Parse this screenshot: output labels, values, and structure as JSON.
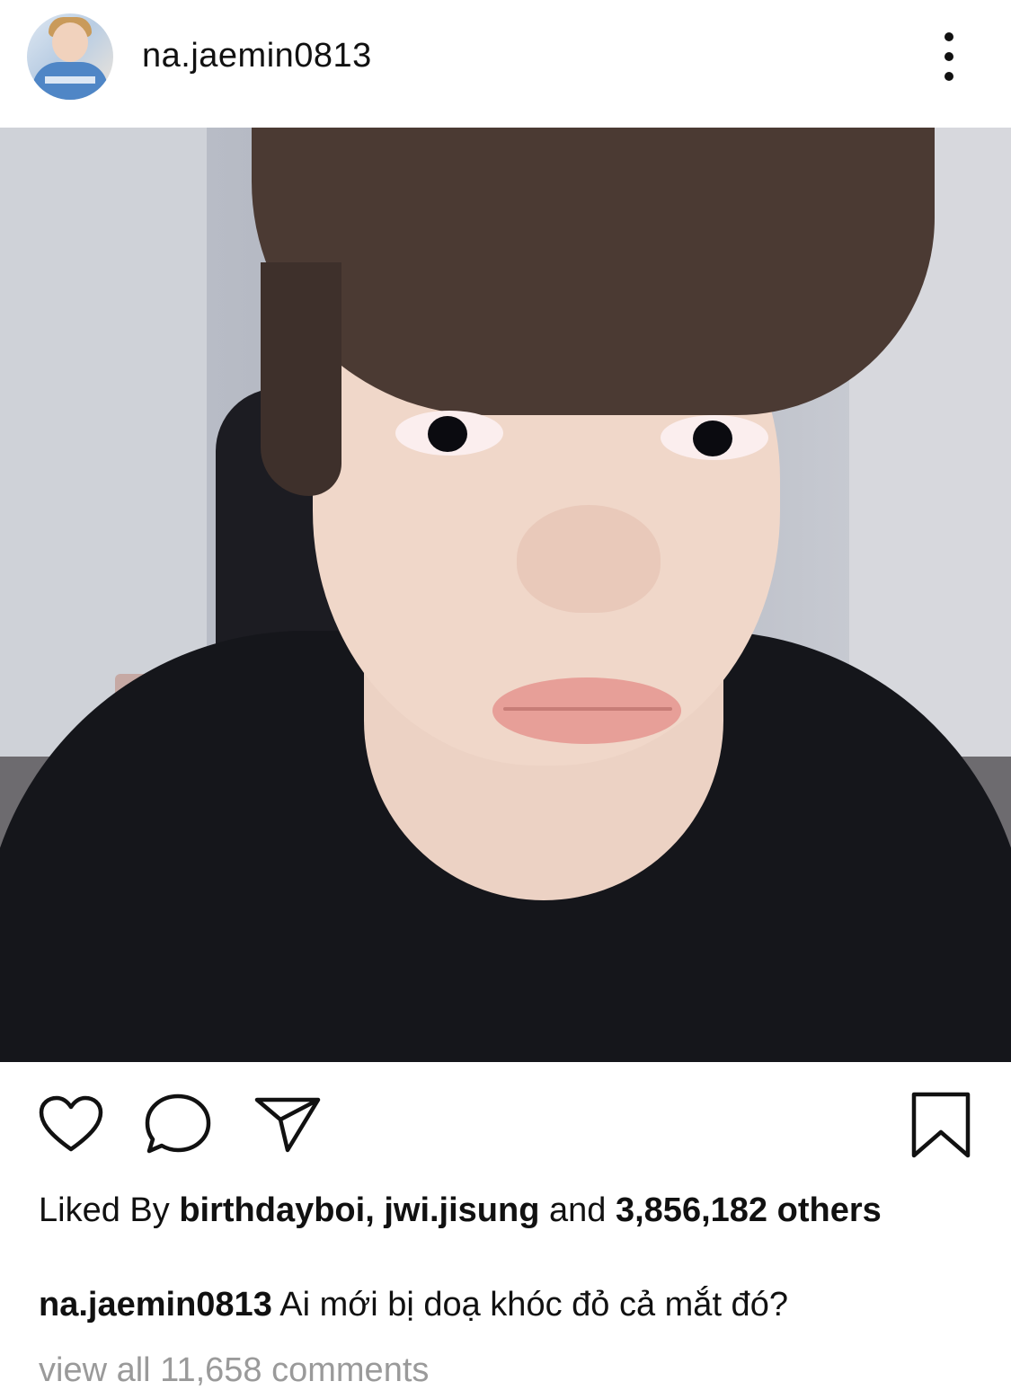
{
  "post": {
    "username": "na.jaemin0813",
    "likes": {
      "prefix": "Liked By",
      "user1": "birthdayboi,",
      "user2": "jwi.jisung",
      "connector": "and",
      "count": "3,856,182",
      "suffix": "others"
    },
    "caption": {
      "username": "na.jaemin0813",
      "text": "Ai mới bị doạ khóc đỏ cả mắt đó?"
    },
    "view_comments": "view all 11,658 comments"
  },
  "icons": {
    "more": "more-vertical-icon",
    "like": "heart-icon",
    "comment": "comment-icon",
    "share": "send-icon",
    "save": "bookmark-icon"
  },
  "colors": {
    "text": "#111111",
    "muted": "#9a9a9a",
    "background": "#ffffff"
  }
}
